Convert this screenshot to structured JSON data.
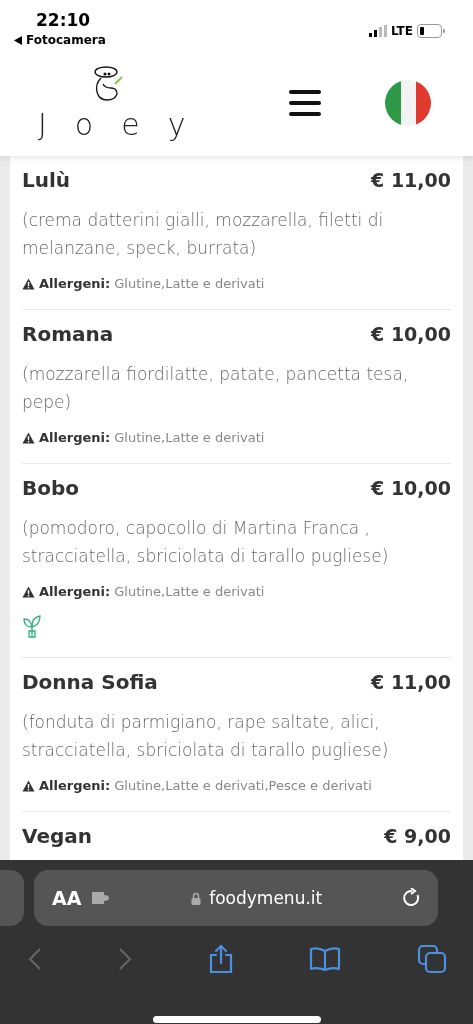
{
  "status_bar": {
    "time": "22:10",
    "back_label": "Fotocamera",
    "network": "LTE"
  },
  "header": {
    "logo": "Joey"
  },
  "items": [
    {
      "name": "Lulù",
      "price": "€ 11,00",
      "description": "(crema datterini gialli, mozzarella, filetti di melanzane, speck, burrata)",
      "allergens_label": "Allergeni:",
      "allergens": "Glutine,Latte e derivati",
      "vegetarian": false
    },
    {
      "name": "Romana",
      "price": "€ 10,00",
      "description": "(mozzarella fiordilatte, patate, pancetta tesa, pepe)",
      "allergens_label": "Allergeni:",
      "allergens": "Glutine,Latte e derivati",
      "vegetarian": false
    },
    {
      "name": "Bobo",
      "price": "€ 10,00",
      "description": "(pomodoro, capocollo di Martina Franca , stracciatella, sbriciolata di tarallo pugliese)",
      "allergens_label": "Allergeni:",
      "allergens": "Glutine,Latte e derivati",
      "vegetarian": true
    },
    {
      "name": "Donna Sofia",
      "price": "€ 11,00",
      "description": "(fonduta di parmigiano, rape saltate, alici, stracciatella, sbriciolata di tarallo pugliese)",
      "allergens_label": "Allergeni:",
      "allergens": "Glutine,Latte e derivati,Pesce e derivati",
      "vegetarian": false
    },
    {
      "name": "Vegan",
      "price": "€ 9,00",
      "vegetarian": false
    }
  ],
  "browser": {
    "text_size": "AA",
    "url": "foodymenu.it"
  }
}
